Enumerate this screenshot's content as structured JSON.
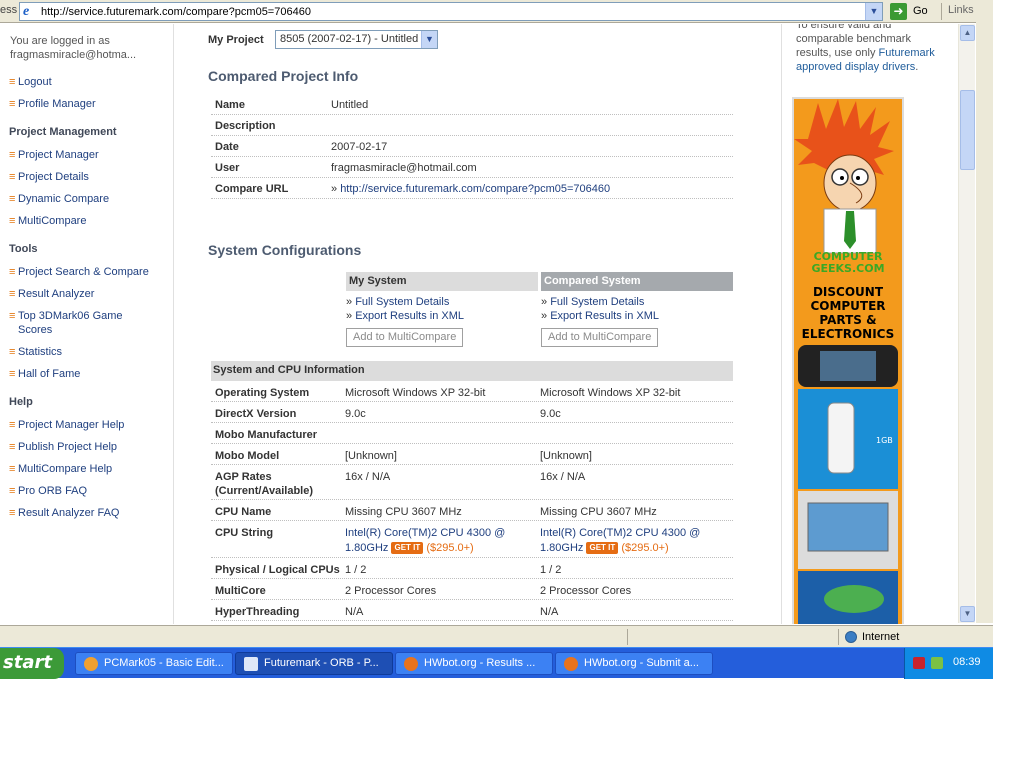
{
  "browser": {
    "address_label": "ess",
    "url": "http://service.futuremark.com/compare?pcm05=706460",
    "go_label": "Go",
    "links_label": "Links",
    "links_chevron": "»"
  },
  "sidebar": {
    "login_text": "You are logged in as fragmasmiracle@hotma...",
    "account": [
      {
        "label": "Logout"
      },
      {
        "label": "Profile Manager"
      }
    ],
    "sections": [
      {
        "heading": "Project Management",
        "items": [
          "Project Manager",
          "Project Details",
          "Dynamic Compare",
          "MultiCompare"
        ]
      },
      {
        "heading": "Tools",
        "items": [
          "Project Search & Compare",
          "Result Analyzer",
          "Top 3DMark06 Game Scores",
          "Statistics",
          "Hall of Fame"
        ]
      },
      {
        "heading": "Help",
        "items": [
          "Project Manager Help",
          "Publish Project Help",
          "MultiCompare Help",
          "Pro ORB FAQ",
          "Result Analyzer FAQ"
        ]
      }
    ]
  },
  "main": {
    "my_project_label": "My Project",
    "project_select_value": "8505 (2007-02-17) - Untitled",
    "compared_title": "Compared Project Info",
    "info": [
      {
        "label": "Name",
        "value": "Untitled"
      },
      {
        "label": "Description",
        "value": ""
      },
      {
        "label": "Date",
        "value": "2007-02-17"
      },
      {
        "label": "User",
        "value": "fragmasmiracle@hotmail.com"
      },
      {
        "label": "Compare URL",
        "value": "http://service.futuremark.com/compare?pcm05=706460"
      }
    ],
    "sys_config_title": "System Configurations",
    "my_system_head": "My System",
    "compared_system_head": "Compared System",
    "full_details_link": "Full System Details",
    "export_xml_link": "Export Results in XML",
    "add_multicompare": "Add to MultiCompare",
    "cpu_section_head": "System and CPU Information",
    "rows": [
      {
        "label": "Operating System",
        "my": "Microsoft Windows XP 32-bit",
        "cmp": "Microsoft Windows XP 32-bit"
      },
      {
        "label": "DirectX Version",
        "my": "9.0c",
        "cmp": "9.0c"
      },
      {
        "label": "Mobo Manufacturer",
        "my": "",
        "cmp": ""
      },
      {
        "label": "Mobo Model",
        "my": "[Unknown]",
        "cmp": "[Unknown]"
      },
      {
        "label": "AGP Rates (Current/Available)",
        "my": "16x / N/A",
        "cmp": "16x / N/A"
      },
      {
        "label": "CPU Name",
        "my": "Missing CPU 3607 MHz",
        "cmp": "Missing CPU 3607 MHz"
      },
      {
        "label": "CPU String",
        "my": "Intel(R) Core(TM)2 CPU 4300 @ 1.80GHz",
        "cmp": "Intel(R) Core(TM)2 CPU 4300 @ 1.80GHz"
      },
      {
        "label": "Physical / Logical CPUs",
        "my": "1 / 2",
        "cmp": "1 / 2"
      },
      {
        "label": "MultiCore",
        "my": "2 Processor Cores",
        "cmp": "2 Processor Cores"
      },
      {
        "label": "HyperThreading",
        "my": "N/A",
        "cmp": "N/A"
      }
    ],
    "getit_label": "GET IT",
    "price": "($295.0+)"
  },
  "right": {
    "note_pre": "To ensure valid and comparable benchmark results, use only ",
    "note_hl": "Futuremark approved display drivers",
    "note_post": ".",
    "ad_logo": "COMPUTER GEEKS.COM",
    "ad_text": "DISCOUNT COMPUTER PARTS & ELECTRONICS"
  },
  "statusbar": {
    "zone": "Internet"
  },
  "taskbar": {
    "start": "start",
    "tasks": [
      "PCMark05 - Basic Edit...",
      "Futuremark - ORB - P...",
      "HWbot.org - Results ...",
      "HWbot.org - Submit a..."
    ],
    "clock": "08:39"
  },
  "colors": {
    "accent_link": "#1f3f7f",
    "nav_bullet": "#e37b18",
    "taskbar": "#245edb",
    "start": "#3c9a38",
    "getit": "#e56c13"
  },
  "icons": [
    "ie-icon",
    "dropdown-arrow-icon",
    "go-arrow-icon",
    "internet-zone-icon",
    "start-logo-icon",
    "shield-icon",
    "network-icon"
  ]
}
